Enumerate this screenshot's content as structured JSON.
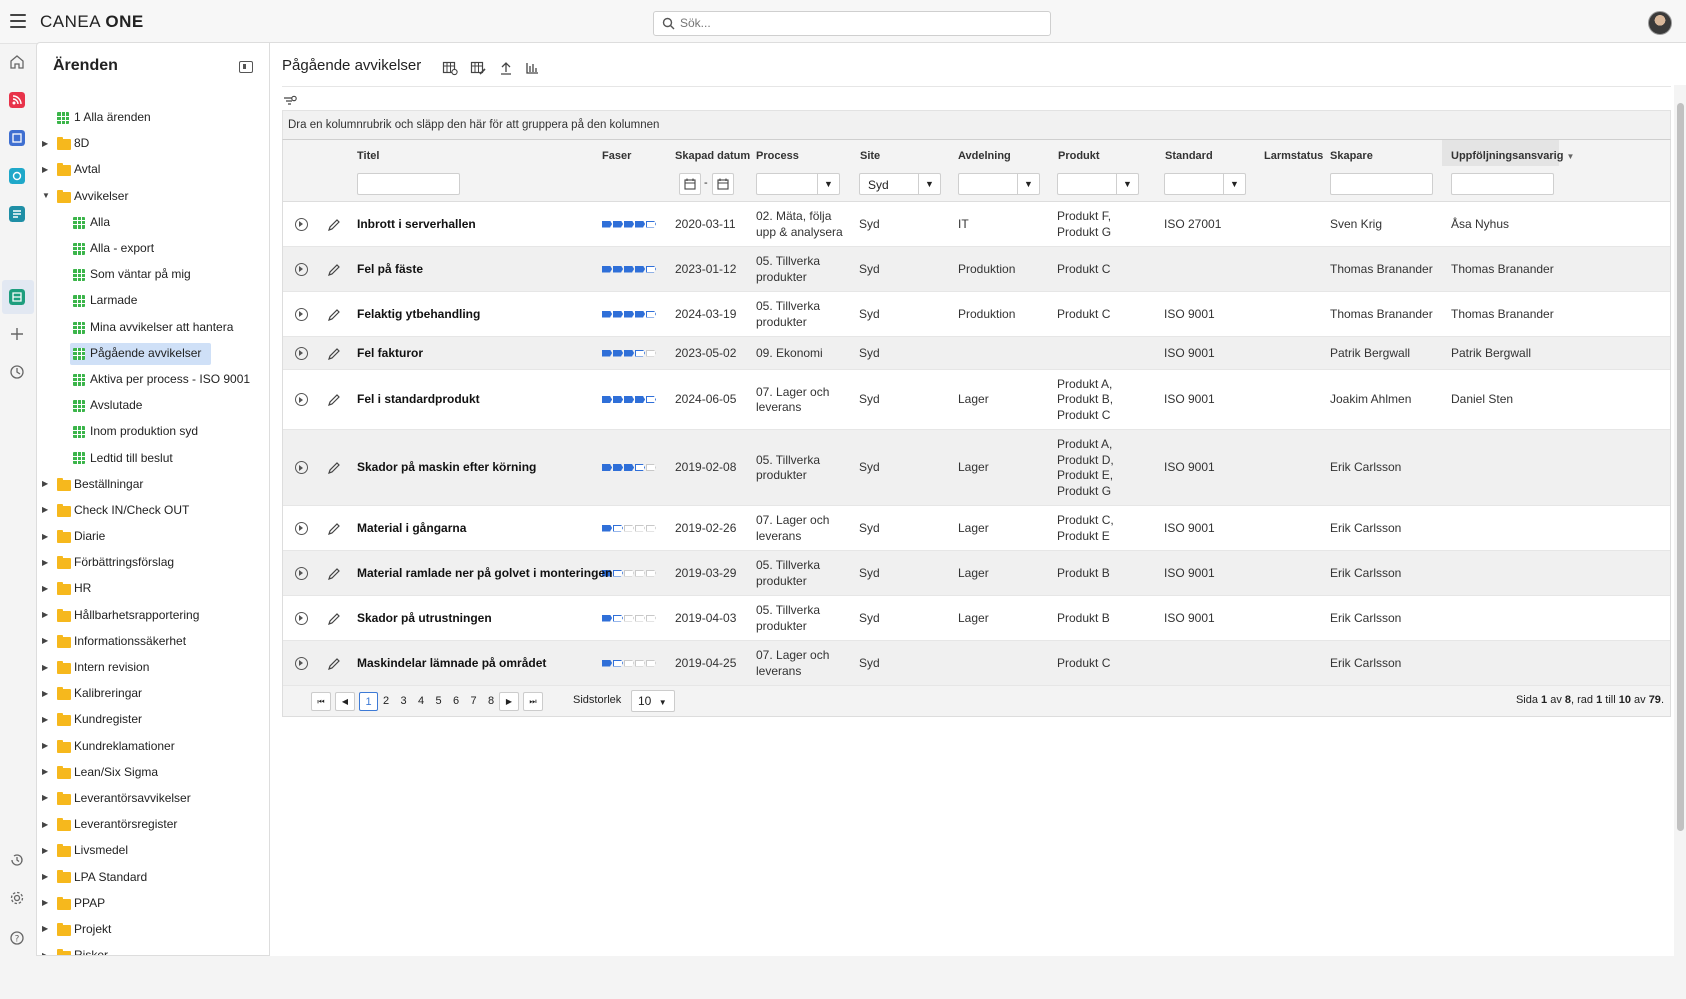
{
  "app": {
    "brand_light": "CANEA ",
    "brand_bold": "ONE",
    "search_placeholder": "Sök..."
  },
  "sidebar": {
    "title": "Ärenden",
    "items": [
      {
        "label": "1 Alla ärenden",
        "type": "view",
        "level": 0
      },
      {
        "label": "8D",
        "type": "folder",
        "level": 0
      },
      {
        "label": "Avtal",
        "type": "folder",
        "level": 0
      },
      {
        "label": "Avvikelser",
        "type": "folder",
        "level": 0,
        "expanded": true
      },
      {
        "label": "Alla",
        "type": "view",
        "level": 1
      },
      {
        "label": "Alla - export",
        "type": "view",
        "level": 1
      },
      {
        "label": "Som väntar på mig",
        "type": "view",
        "level": 1
      },
      {
        "label": "Larmade",
        "type": "view",
        "level": 1
      },
      {
        "label": "Mina avvikelser att hantera",
        "type": "view",
        "level": 1
      },
      {
        "label": "Pågående avvikelser",
        "type": "view",
        "level": 1,
        "selected": true
      },
      {
        "label": "Aktiva per process - ISO 9001",
        "type": "view",
        "level": 1
      },
      {
        "label": "Avslutade",
        "type": "view",
        "level": 1
      },
      {
        "label": "Inom produktion syd",
        "type": "view",
        "level": 1
      },
      {
        "label": "Ledtid till beslut",
        "type": "view",
        "level": 1
      },
      {
        "label": "Beställningar",
        "type": "folder",
        "level": 0
      },
      {
        "label": "Check IN/Check OUT",
        "type": "folder",
        "level": 0
      },
      {
        "label": "Diarie",
        "type": "folder",
        "level": 0
      },
      {
        "label": "Förbättringsförslag",
        "type": "folder",
        "level": 0
      },
      {
        "label": "HR",
        "type": "folder",
        "level": 0
      },
      {
        "label": "Hållbarhetsrapportering",
        "type": "folder",
        "level": 0
      },
      {
        "label": "Informationssäkerhet",
        "type": "folder",
        "level": 0
      },
      {
        "label": "Intern revision",
        "type": "folder",
        "level": 0
      },
      {
        "label": "Kalibreringar",
        "type": "folder",
        "level": 0
      },
      {
        "label": "Kundregister",
        "type": "folder",
        "level": 0
      },
      {
        "label": "Kundreklamationer",
        "type": "folder",
        "level": 0
      },
      {
        "label": "Lean/Six Sigma",
        "type": "folder",
        "level": 0
      },
      {
        "label": "Leverantörsavvikelser",
        "type": "folder",
        "level": 0
      },
      {
        "label": "Leverantörsregister",
        "type": "folder",
        "level": 0
      },
      {
        "label": "Livsmedel",
        "type": "folder",
        "level": 0
      },
      {
        "label": "LPA Standard",
        "type": "folder",
        "level": 0
      },
      {
        "label": "PPAP",
        "type": "folder",
        "level": 0
      },
      {
        "label": "Projekt",
        "type": "folder",
        "level": 0
      },
      {
        "label": "Risker",
        "type": "folder",
        "level": 0
      }
    ]
  },
  "main": {
    "title": "Pågående avvikelser",
    "group_hint": "Dra en kolumnrubrik och släpp den här för att gruppera på den kolumnen",
    "columns": {
      "titel": "Titel",
      "faser": "Faser",
      "skapad": "Skapad datum",
      "process": "Process",
      "site": "Site",
      "avdelning": "Avdelning",
      "produkt": "Produkt",
      "standard": "Standard",
      "larmstatus": "Larmstatus",
      "skapare": "Skapare",
      "uppfoljning": "Uppföljningsansvarig"
    },
    "filters": {
      "site_value": "Syd",
      "date_separator": "-"
    },
    "rows": [
      {
        "titel": "Inbrott i serverhallen",
        "phases": 4,
        "datum": "2020-03-11",
        "process": "02. Mäta, följa\nupp & analysera",
        "site": "Syd",
        "avdelning": "IT",
        "produkt": "Produkt F,\nProdukt G",
        "standard": "ISO 27001",
        "skapare": "Sven Krig",
        "ansvarig": "Åsa Nyhus"
      },
      {
        "titel": "Fel på fäste",
        "phases": 4,
        "datum": "2023-01-12",
        "process": "05. Tillverka\nprodukter",
        "site": "Syd",
        "avdelning": "Produktion",
        "produkt": "Produkt C",
        "standard": "",
        "skapare": "Thomas Branander",
        "ansvarig": "Thomas Branander"
      },
      {
        "titel": "Felaktig ytbehandling",
        "phases": 4,
        "datum": "2024-03-19",
        "process": "05. Tillverka\nprodukter",
        "site": "Syd",
        "avdelning": "Produktion",
        "produkt": "Produkt C",
        "standard": "ISO 9001",
        "skapare": "Thomas Branander",
        "ansvarig": "Thomas Branander"
      },
      {
        "titel": "Fel fakturor",
        "phases": 3,
        "datum": "2023-05-02",
        "process": "09. Ekonomi",
        "site": "Syd",
        "avdelning": "",
        "produkt": "",
        "standard": "ISO 9001",
        "skapare": "Patrik Bergwall",
        "ansvarig": "Patrik Bergwall"
      },
      {
        "titel": "Fel i standardprodukt",
        "phases": 4,
        "datum": "2024-06-05",
        "process": "07. Lager och\nleverans",
        "site": "Syd",
        "avdelning": "Lager",
        "produkt": "Produkt A,\nProdukt B,\nProdukt C",
        "standard": "ISO 9001",
        "skapare": "Joakim Ahlmen",
        "ansvarig": "Daniel Sten"
      },
      {
        "titel": "Skador på maskin efter körning",
        "phases": 3,
        "datum": "2019-02-08",
        "process": "05. Tillverka\nprodukter",
        "site": "Syd",
        "avdelning": "Lager",
        "produkt": "Produkt A,\nProdukt D,\nProdukt E,\nProdukt G",
        "standard": "ISO 9001",
        "skapare": "Erik Carlsson",
        "ansvarig": ""
      },
      {
        "titel": "Material i gångarna",
        "phases": 1,
        "datum": "2019-02-26",
        "process": "07. Lager och\nleverans",
        "site": "Syd",
        "avdelning": "Lager",
        "produkt": "Produkt C,\nProdukt E",
        "standard": "ISO 9001",
        "skapare": "Erik Carlsson",
        "ansvarig": ""
      },
      {
        "titel": "Material ramlade ner på golvet i monteringen",
        "phases": 1,
        "datum": "2019-03-29",
        "process": "05. Tillverka\nprodukter",
        "site": "Syd",
        "avdelning": "Lager",
        "produkt": "Produkt B",
        "standard": "ISO 9001",
        "skapare": "Erik Carlsson",
        "ansvarig": ""
      },
      {
        "titel": "Skador på utrustningen",
        "phases": 1,
        "datum": "2019-04-03",
        "process": "05. Tillverka\nprodukter",
        "site": "Syd",
        "avdelning": "Lager",
        "produkt": "Produkt B",
        "standard": "ISO 9001",
        "skapare": "Erik Carlsson",
        "ansvarig": ""
      },
      {
        "titel": "Maskindelar lämnade på området",
        "phases": 1,
        "datum": "2019-04-25",
        "process": "07. Lager och\nleverans",
        "site": "Syd",
        "avdelning": "",
        "produkt": "Produkt C",
        "standard": "",
        "skapare": "Erik Carlsson",
        "ansvarig": ""
      }
    ],
    "pager": {
      "pages": [
        "1",
        "2",
        "3",
        "4",
        "5",
        "6",
        "7",
        "8"
      ],
      "current": "1",
      "size_label": "Sidstorlek",
      "size_value": "10",
      "info_prefix": "Sida ",
      "info_page": "1",
      "info_of": " av ",
      "info_pages": "8",
      "info_row": ", rad ",
      "info_from": "1",
      "info_to_word": " till ",
      "info_to": "10",
      "info_total_word": " av ",
      "info_total": "79",
      "info_end": "."
    }
  },
  "colors": {
    "accent": "#2f6fd8",
    "folder": "#f6b81d",
    "grid_icon": "#3bb54a",
    "selected": "#cfe0f7"
  }
}
